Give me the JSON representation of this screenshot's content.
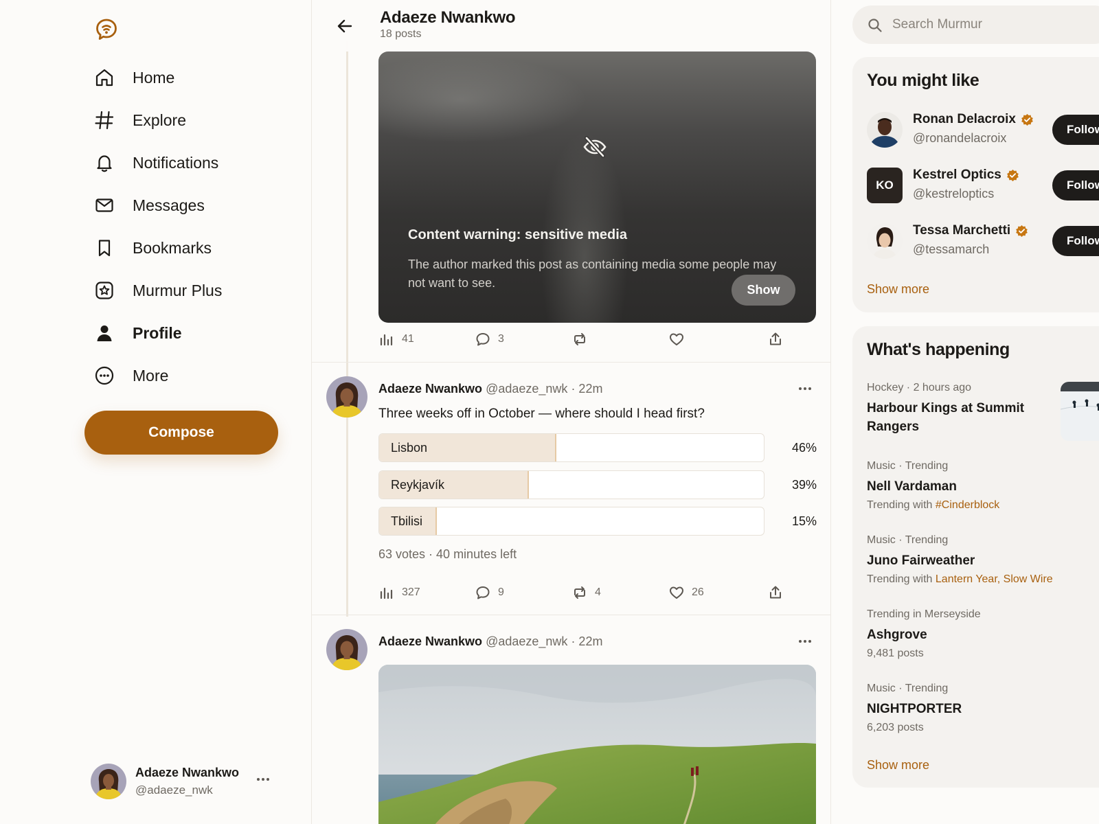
{
  "nav": {
    "items": [
      {
        "label": "Home",
        "icon": "home-icon"
      },
      {
        "label": "Explore",
        "icon": "hashtag-icon"
      },
      {
        "label": "Notifications",
        "icon": "bell-icon"
      },
      {
        "label": "Messages",
        "icon": "envelope-icon"
      },
      {
        "label": "Bookmarks",
        "icon": "bookmark-icon"
      },
      {
        "label": "Murmur Plus",
        "icon": "star-badge-icon"
      },
      {
        "label": "Profile",
        "icon": "person-icon"
      },
      {
        "label": "More",
        "icon": "more-circle-icon"
      }
    ],
    "active": "Profile",
    "compose_label": "Compose"
  },
  "current_user": {
    "name": "Adaeze Nwankwo",
    "handle": "@adaeze_nwk"
  },
  "profile_header": {
    "name": "Adaeze Nwankwo",
    "count": "18 posts"
  },
  "feed": {
    "sensitive_post": {
      "warning_title": "Content warning: sensitive media",
      "warning_text": "The author marked this post as containing media some people may not want to see.",
      "show_label": "Show",
      "stats": {
        "views": "41",
        "replies": "3",
        "reposts": "",
        "likes": ""
      }
    },
    "poll_post": {
      "author": "Adaeze Nwankwo",
      "handle": "@adaeze_nwk",
      "time": "· 22m",
      "text": "Three weeks off in October — where should I head first?",
      "options": [
        {
          "label": "Lisbon",
          "percent": 46,
          "percent_label": "46%"
        },
        {
          "label": "Reykjavík",
          "percent": 39,
          "percent_label": "39%"
        },
        {
          "label": "Tbilisi",
          "percent": 15,
          "percent_label": "15%"
        }
      ],
      "info": "63 votes · 40 minutes left",
      "stats": {
        "views": "327",
        "replies": "9",
        "reposts": "4",
        "likes": "26"
      }
    },
    "photo_post": {
      "author": "Adaeze Nwankwo",
      "handle": "@adaeze_nwk",
      "time": "· 22m"
    }
  },
  "search": {
    "placeholder": "Search Murmur"
  },
  "suggestions": {
    "title": "You might like",
    "users": [
      {
        "name": "Ronan Delacroix",
        "handle": "@ronandelacroix",
        "verified": true,
        "follow_label": "Follow"
      },
      {
        "name": "Kestrel Optics",
        "handle": "@kestreloptics",
        "verified": true,
        "initials": "KO",
        "follow_label": "Follow"
      },
      {
        "name": "Tessa Marchetti",
        "handle": "@tessamarch",
        "verified": true,
        "follow_label": "Follow"
      }
    ],
    "show_more": "Show more"
  },
  "trends": {
    "title": "What's happening",
    "items": [
      {
        "meta": "Hockey · 2 hours ago",
        "title": "Harbour Kings at Summit Rangers"
      },
      {
        "meta": "Music · Trending",
        "title": "Nell Vardaman",
        "sub_prefix": "Trending with ",
        "sub_tags": "#Cinderblock"
      },
      {
        "meta": "Music · Trending",
        "title": "Juno Fairweather",
        "sub_prefix": "Trending with ",
        "sub_tags": "Lantern Year, Slow Wire"
      },
      {
        "meta": "Trending in Merseyside",
        "title": "Ashgrove",
        "sub": "9,481 posts"
      },
      {
        "meta": "Music · Trending",
        "title": "NIGHTPORTER",
        "sub": "6,203 posts"
      }
    ],
    "show_more": "Show more"
  },
  "colors": {
    "accent": "#a8600f",
    "verified": "#c77712",
    "poll_fill": "#f1e6d9",
    "dark_button": "#1e1c1a"
  }
}
